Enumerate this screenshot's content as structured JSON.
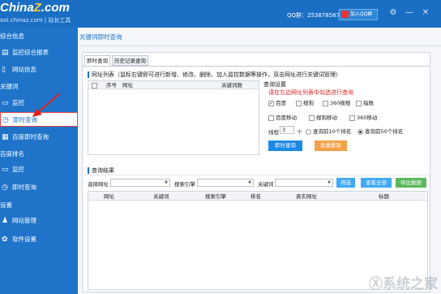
{
  "app": {
    "logo_main": "China",
    "logo_z": "Z",
    "logo_suffix": ".com",
    "logo_sub": "ool.chinaz.com | 站长工具",
    "qq_group": "QQ群：253878567",
    "add_qq_button": "加入QQ群"
  },
  "window_controls": {
    "settings": "⚙",
    "minimize": "—",
    "close": "✕"
  },
  "sidebar": {
    "sections": [
      {
        "title": "综合信息"
      },
      {
        "title": "关键词"
      },
      {
        "title": "百度排名"
      },
      {
        "title": "设置"
      }
    ],
    "items": [
      {
        "label": "监控综合报表",
        "icon": "chart-icon"
      },
      {
        "label": "网站信息",
        "icon": "document-icon"
      },
      {
        "label": "监控",
        "icon": "monitor-icon"
      },
      {
        "label": "即时查询",
        "icon": "clock-icon"
      },
      {
        "label": "百度即时查询",
        "icon": "grid-icon"
      },
      {
        "label": "监控",
        "icon": "monitor-icon"
      },
      {
        "label": "即时查询",
        "icon": "clock-icon"
      },
      {
        "label": "网站管理",
        "icon": "users-icon"
      },
      {
        "label": "软件设置",
        "icon": "gear-icon"
      }
    ]
  },
  "main": {
    "breadcrumb": "关键词即时查询",
    "tabs": [
      {
        "label": "即时查询"
      },
      {
        "label": "历史记录查询"
      }
    ],
    "url_list": {
      "title": "网址列表（鼠标右键即可进行新增、修改、删除、加入监控数据等操作，双击网址进行关键词管理）",
      "headers": [
        "序号",
        "网址",
        "关键词数"
      ]
    },
    "query_settings": {
      "title": "查询设置",
      "hint": "请在左边网址列表中勾选进行查询",
      "engines": [
        {
          "label": "百度",
          "checked": true
        },
        {
          "label": "搜狗",
          "checked": false
        },
        {
          "label": "360搜搜",
          "checked": false
        },
        {
          "label": "指数",
          "checked": false
        },
        {
          "label": "百度移动",
          "checked": false
        },
        {
          "label": "搜狗移动",
          "checked": false
        },
        {
          "label": "360移动",
          "checked": false
        }
      ],
      "threads_label": "线程",
      "threads_value": "3",
      "threads_unit": "个",
      "rank_options": [
        {
          "label": "查询前10个排名",
          "selected": false
        },
        {
          "label": "查询前50个排名",
          "selected": true
        }
      ],
      "query_button": "即时查询",
      "batch_delete_button": "批量删除"
    },
    "results": {
      "title": "查询结果",
      "select_site_label": "选择网址",
      "engine_label": "搜索引擎",
      "keyword_label": "关键词",
      "filter_button": "筛选",
      "view_all_button": "查看全部",
      "export_button": "导出数据",
      "columns": [
        "网址",
        "关键词",
        "搜索引擎",
        "排名",
        "真实网址",
        "标题"
      ]
    }
  },
  "colors": {
    "brand_blue": "#1a6fc4",
    "query_button": "#1e88e5",
    "delete_button": "#f5a04a",
    "filter_button": "#3fa9f5",
    "export_button": "#5cb85c",
    "hint_red": "#e02020"
  }
}
